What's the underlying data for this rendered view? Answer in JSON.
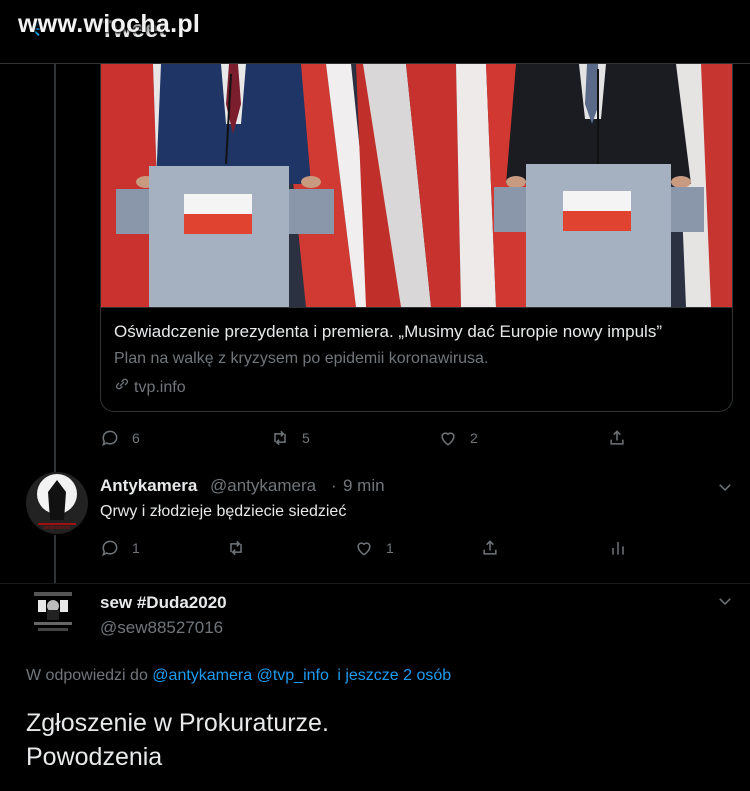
{
  "header": {
    "title": "Tweet",
    "watermark": "www.wiocha.pl"
  },
  "card": {
    "title": "Oświadczenie prezydenta i premiera. „Musimy dać Europie nowy impuls”",
    "description": "Plan na walkę z kryzysem po epidemii koronawirusa.",
    "link": "tvp.info"
  },
  "main_tweet_actions": {
    "replies": "6",
    "retweets": "5",
    "likes": "2"
  },
  "reply1": {
    "name": "Antykamera",
    "handle": "@antykamera",
    "separator": "·",
    "time": "9 min",
    "text": "Qrwy i złodzieje będziecie siedzieć",
    "replies": "1",
    "retweets": "",
    "likes": "1"
  },
  "reply2": {
    "name": "sew #Duda2020",
    "handle": "@sew88527016",
    "reply_prefix": "W odpowiedzi do",
    "mention1": "@antykamera",
    "mention2": "@tvp_info",
    "mention_more": "i jeszcze 2 osób",
    "text_line1": "Zgłoszenie w Prokuraturze.",
    "text_line2": "Powodzenia"
  },
  "colors": {
    "background": "#000000",
    "accent": "#1d9bf0",
    "muted": "#71767b",
    "text": "#e7e9ea"
  }
}
